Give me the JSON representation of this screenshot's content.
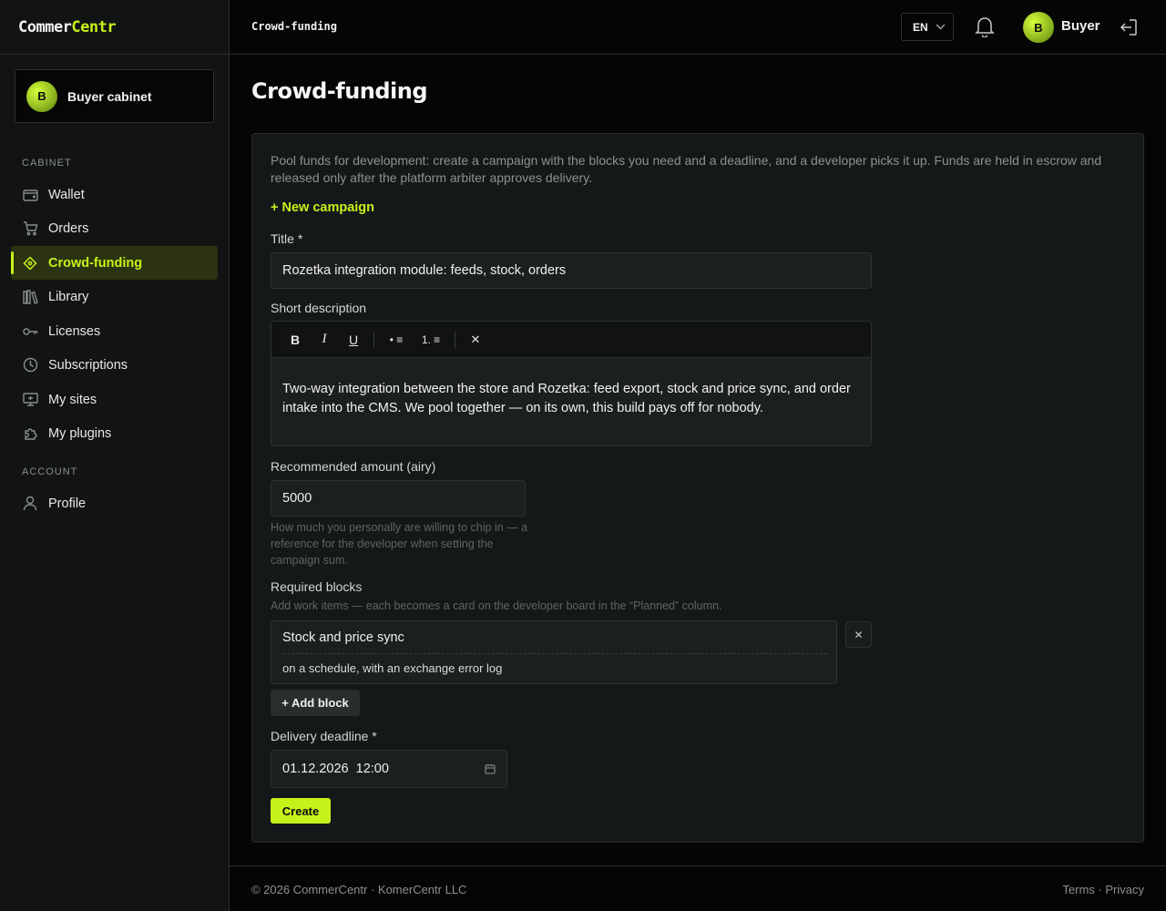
{
  "brand": {
    "part1": "Commer",
    "part2": "Centr"
  },
  "sidebar": {
    "cabinet_avatar": "B",
    "cabinet_label": "Buyer cabinet",
    "section_cabinet": "CABINET",
    "section_account": "ACCOUNT",
    "items": [
      {
        "label": "Wallet",
        "icon": "wallet-icon"
      },
      {
        "label": "Orders",
        "icon": "cart-icon"
      },
      {
        "label": "Crowd-funding",
        "icon": "diamond-icon",
        "active": true
      },
      {
        "label": "Library",
        "icon": "books-icon"
      },
      {
        "label": "Licenses",
        "icon": "key-icon"
      },
      {
        "label": "Subscriptions",
        "icon": "clock-icon"
      },
      {
        "label": "My sites",
        "icon": "monitor-icon"
      },
      {
        "label": "My plugins",
        "icon": "puzzle-icon"
      }
    ],
    "account_items": [
      {
        "label": "Profile",
        "icon": "user-icon"
      }
    ]
  },
  "header": {
    "breadcrumb": "Crowd-funding",
    "lang": "EN",
    "user_initial": "B",
    "user_name": "Buyer"
  },
  "main": {
    "title": "Crowd-funding",
    "intro": "Pool funds for development: create a campaign with the blocks you need and a deadline, and a developer picks it up. Funds are held in escrow and released only after the platform arbiter approves delivery.",
    "new_campaign": "+ New campaign",
    "title_label": "Title *",
    "title_value": "Rozetka integration module: feeds, stock, orders",
    "desc_label": "Short description",
    "toolbar": {
      "bold": "B",
      "italic": "I",
      "underline": "U",
      "bullets": "• ≡",
      "numbered": "1. ≡",
      "clear": "✕"
    },
    "desc_value": "Two-way integration between the store and Rozetka: feed export, stock and price sync, and order intake into the CMS. We pool together — on its own, this build pays off for nobody.",
    "amount_label": "Recommended amount (airy)",
    "amount_value": "5000",
    "amount_hint": "How much you personally are willing to chip in — a reference for the developer when setting the campaign sum.",
    "blocks_label": "Required blocks",
    "blocks_hint": "Add work items — each becomes a card on the developer board in the “Planned” column.",
    "blocks": [
      {
        "title": "Stock and price sync",
        "description": "on a schedule, with an exchange error log"
      }
    ],
    "remove_block": "✕",
    "add_block": "+ Add block",
    "deadline_label": "Delivery deadline *",
    "deadline_value": "01.12.2026  12:00",
    "create": "Create"
  },
  "footer": {
    "copyright": "© 2026 CommerCentr · KomerCentr LLC",
    "terms": "Terms",
    "dot": " · ",
    "privacy": "Privacy"
  },
  "colors": {
    "accent": "#c6f21a",
    "background": "#050505",
    "panel": "#151819"
  }
}
